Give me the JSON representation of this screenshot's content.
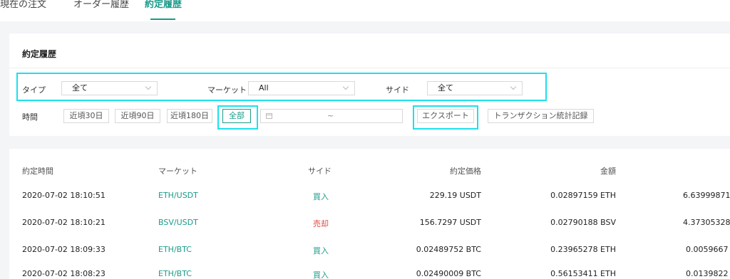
{
  "tabs": [
    {
      "label": "現在の注文"
    },
    {
      "label": "オーダー履歴"
    },
    {
      "label": "約定履歴"
    }
  ],
  "filter_panel": {
    "title": "約定履歴",
    "type_label": "タイプ",
    "type_value": "全て",
    "market_label": "マーケット",
    "market_value": "All",
    "side_label": "サイド",
    "side_value": "全て",
    "time_label": "時間",
    "time_buttons": [
      "近頃30日",
      "近頃90日",
      "近頃180日",
      "全部"
    ],
    "date_separator": "~",
    "export_label": "エクスポート",
    "stats_label": "トランザクション統計記録"
  },
  "table": {
    "headers": [
      "約定時間",
      "マーケット",
      "サイド",
      "約定価格",
      "金額"
    ],
    "rows": [
      {
        "time": "2020-07-02 18:10:51",
        "market": "ETH/USDT",
        "side": "買入",
        "price": "229.19 USDT",
        "amount": "0.02897159 ETH",
        "total": "6.63999871"
      },
      {
        "time": "2020-07-02 18:10:21",
        "market": "BSV/USDT",
        "side": "売却",
        "price": "156.7297 USDT",
        "amount": "0.02790188 BSV",
        "total": "4.37305328"
      },
      {
        "time": "2020-07-02 18:09:33",
        "market": "ETH/BTC",
        "side": "買入",
        "price": "0.02489752 BTC",
        "amount": "0.23965278 ETH",
        "total": "0.0059667"
      },
      {
        "time": "2020-07-02 18:08:23",
        "market": "ETH/BTC",
        "side": "買入",
        "price": "0.02490009 BTC",
        "amount": "0.56153411 ETH",
        "total": "0.0139822"
      }
    ]
  },
  "colors": {
    "accent": "#1a9b8a",
    "sell": "#e0473c",
    "highlight": "#1ee0ec"
  }
}
